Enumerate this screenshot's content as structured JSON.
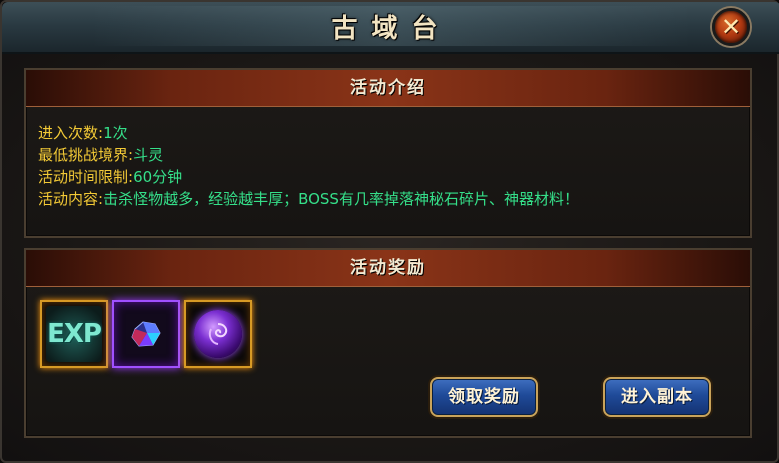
{
  "window": {
    "title": "古域台"
  },
  "close": {
    "label": "✕"
  },
  "activity_intro": {
    "header": "活动介绍",
    "rows": [
      {
        "label": "进入次数:",
        "value": "1次"
      },
      {
        "label": "最低挑战境界:",
        "value": "斗灵"
      },
      {
        "label": "活动时间限制:",
        "value": "60分钟"
      },
      {
        "label": "活动内容:",
        "value": "击杀怪物越多，经验越丰厚；BOSS有几率掉落神秘石碎片、神器材料！"
      }
    ]
  },
  "activity_rewards": {
    "header": "活动奖励",
    "items": [
      {
        "icon": "exp-icon",
        "text": "EXP"
      },
      {
        "icon": "gem-icon"
      },
      {
        "icon": "purple-orb-icon"
      }
    ]
  },
  "buttons": {
    "claim_label": "领取奖励",
    "enter_label": "进入副本"
  }
}
